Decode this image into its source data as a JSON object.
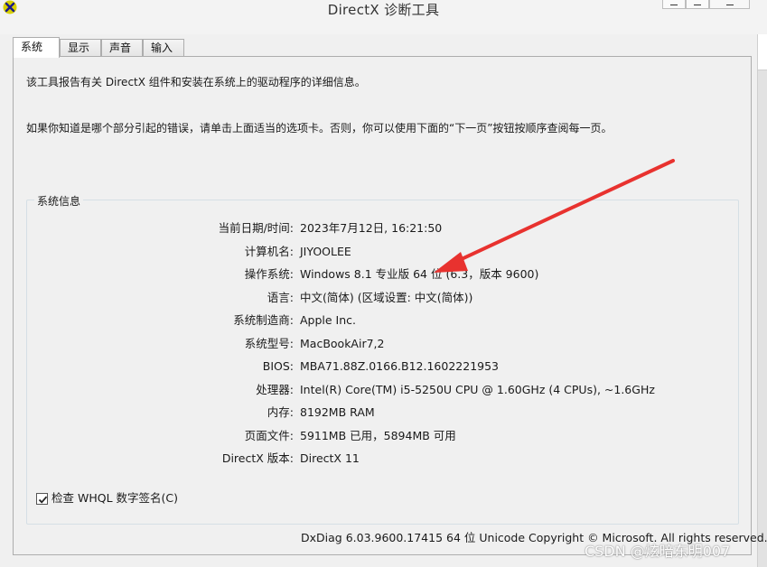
{
  "window": {
    "title": "DirectX 诊断工具"
  },
  "tabs": [
    {
      "label": "系统",
      "active": true
    },
    {
      "label": "显示",
      "active": false
    },
    {
      "label": "声音",
      "active": false
    },
    {
      "label": "输入",
      "active": false
    }
  ],
  "intro": {
    "line1": "该工具报告有关 DirectX 组件和安装在系统上的驱动程序的详细信息。",
    "line2": "如果你知道是哪个部分引起的错误，请单击上面适当的选项卡。否则，你可以使用下面的“下一页”按钮按顺序查阅每一页。"
  },
  "system_info": {
    "group_title": "系统信息",
    "rows": [
      {
        "label": "当前日期/时间:",
        "value": "2023年7月12日, 16:21:50"
      },
      {
        "label": "计算机名:",
        "value": "JIYOOLEE"
      },
      {
        "label": "操作系统:",
        "value": "Windows 8.1 专业版 64 位 (6.3，版本 9600)"
      },
      {
        "label": "语言:",
        "value": "中文(简体) (区域设置: 中文(简体))"
      },
      {
        "label": "系统制造商:",
        "value": "Apple Inc."
      },
      {
        "label": "系统型号:",
        "value": "MacBookAir7,2"
      },
      {
        "label": "BIOS:",
        "value": "MBA71.88Z.0166.B12.1602221953"
      },
      {
        "label": "处理器:",
        "value": "Intel(R) Core(TM) i5-5250U CPU @ 1.60GHz (4 CPUs), ~1.6GHz"
      },
      {
        "label": "内存:",
        "value": "8192MB RAM"
      },
      {
        "label": "页面文件:",
        "value": "5911MB 已用，5894MB 可用"
      },
      {
        "label": "DirectX 版本:",
        "value": "DirectX 11"
      }
    ]
  },
  "whql_check": {
    "label": "检查 WHQL 数字签名(C)",
    "checked": true
  },
  "footer": {
    "text": "DxDiag 6.03.9600.17415 64 位 Unicode  Copyright © Microsoft. All rights reserved."
  },
  "watermark": {
    "text": "CSDN @炫暗东明007"
  },
  "colors": {
    "arrow": "#e8322f",
    "panel_bg": "#f0f0f0",
    "tab_active_bg": "#ffffff"
  },
  "icons": {
    "app": "directx-icon",
    "checkbox": "check-icon"
  }
}
